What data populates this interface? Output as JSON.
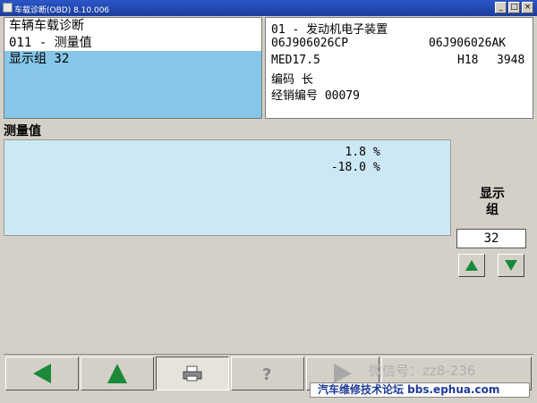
{
  "window": {
    "title": "车载诊断(OBD) 8.10.006",
    "buttons": {
      "minimize": "_",
      "maximize": "□",
      "close": "×"
    }
  },
  "left_panel": {
    "title": "车辆车载诊断",
    "function": "011 - 测量值",
    "selected": "显示组 32"
  },
  "right_panel": {
    "module": "01 - 发动机电子装置",
    "part_no_1": "06J906026CP",
    "part_no_2": "06J906026AK",
    "ecu": "MED17.5",
    "version_a": "H18",
    "version_b": "3948",
    "coding": "编码 长",
    "dealer": "经销编号 00079"
  },
  "values_section": {
    "title": "测量值",
    "rows": [
      {
        "value": "1.8",
        "unit": "%"
      },
      {
        "value": "-18.0",
        "unit": "%"
      }
    ]
  },
  "display_group": {
    "label_line1": "显示",
    "label_line2": "组",
    "value": "32"
  },
  "watermark": {
    "wechat": "微信号：zz8-236",
    "forum": "汽车维修技术论坛 bbs.ephua.com"
  },
  "colors": {
    "selected_row": "#86c6e8",
    "values_bg": "#cde8f5",
    "arrow_green": "#1a8a3a"
  }
}
